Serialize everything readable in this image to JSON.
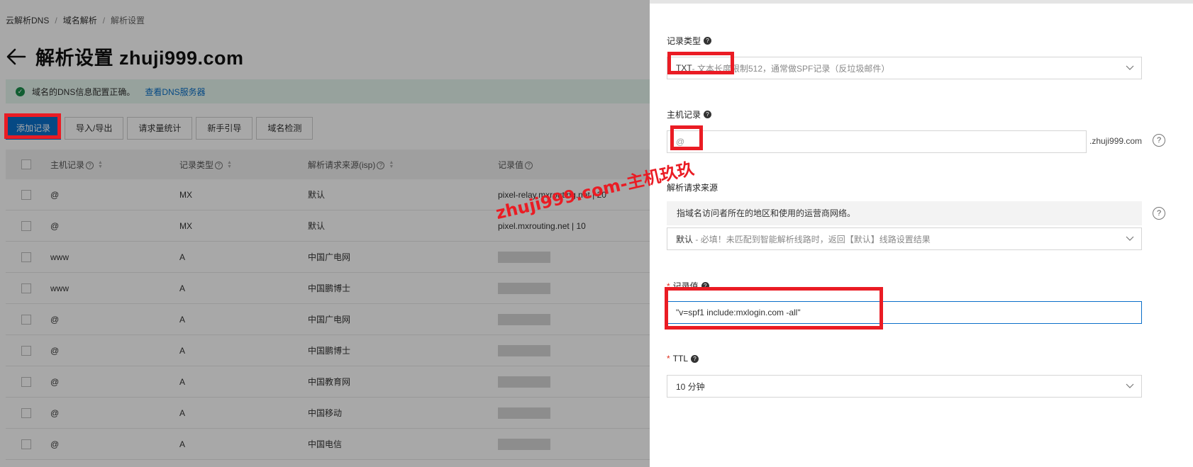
{
  "breadcrumb": [
    "云解析DNS",
    "域名解析",
    "解析设置"
  ],
  "page_title": "解析设置 zhuji999.com",
  "notice": {
    "text": "域名的DNS信息配置正确。",
    "link": "查看DNS服务器"
  },
  "toolbar": {
    "buttons": [
      "添加记录",
      "导入/导出",
      "请求量统计",
      "新手引导",
      "域名检测"
    ]
  },
  "table": {
    "columns": [
      "主机记录",
      "记录类型",
      "解析请求来源(isp)",
      "记录值"
    ],
    "rows": [
      {
        "host": "@",
        "type": "MX",
        "isp": "默认",
        "value": "pixel-relay.mxrouting.net | 20"
      },
      {
        "host": "@",
        "type": "MX",
        "isp": "默认",
        "value": "pixel.mxrouting.net | 10"
      },
      {
        "host": "www",
        "type": "A",
        "isp": "中国广电网",
        "value": ""
      },
      {
        "host": "www",
        "type": "A",
        "isp": "中国鹏博士",
        "value": ""
      },
      {
        "host": "@",
        "type": "A",
        "isp": "中国广电网",
        "value": ""
      },
      {
        "host": "@",
        "type": "A",
        "isp": "中国鹏博士",
        "value": ""
      },
      {
        "host": "@",
        "type": "A",
        "isp": "中国教育网",
        "value": ""
      },
      {
        "host": "@",
        "type": "A",
        "isp": "中国移动",
        "value": ""
      },
      {
        "host": "@",
        "type": "A",
        "isp": "中国电信",
        "value": ""
      }
    ]
  },
  "watermark": "zhuji999.com-主机玖玖",
  "drawer": {
    "record_type": {
      "label": "记录类型",
      "value_main": "TXT",
      "value_desc": "- 文本长度限制512，通常做SPF记录（反垃圾邮件）"
    },
    "host_record": {
      "label": "主机记录",
      "value": "@",
      "suffix": ".zhuji999.com"
    },
    "isp_source": {
      "label": "解析请求来源",
      "description": "指域名访问者所在的地区和使用的运营商网络。",
      "value_main": "默认",
      "value_desc": "- 必填！未匹配到智能解析线路时，返回【默认】线路设置结果"
    },
    "record_value": {
      "label": "记录值",
      "value": "\"v=spf1 include:mxlogin.com -all\""
    },
    "ttl": {
      "label": "TTL",
      "value": "10 分钟"
    }
  },
  "colors": {
    "accent": "#0a6fc9",
    "highlight": "#ea1c24",
    "success": "#1a8f4c"
  }
}
